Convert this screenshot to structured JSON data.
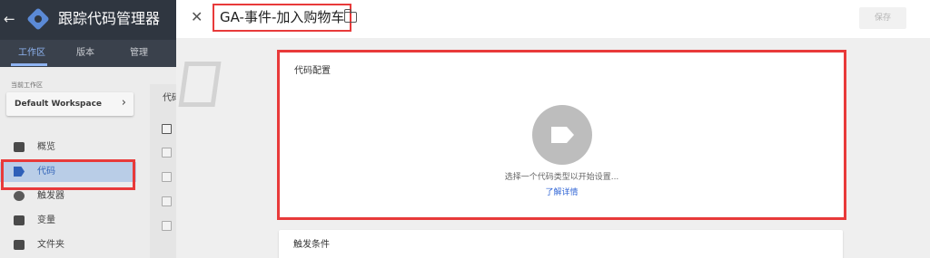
{
  "app": {
    "title": "跟踪代码管理器",
    "tabs": [
      "工作区",
      "版本",
      "管理"
    ],
    "workspace": {
      "label": "当前工作区",
      "name": "Default Workspace"
    },
    "nav": [
      {
        "label": "概览",
        "icon": "overview-icon"
      },
      {
        "label": "代码",
        "icon": "tag-icon"
      },
      {
        "label": "触发器",
        "icon": "trigger-icon"
      },
      {
        "label": "变量",
        "icon": "variable-icon"
      },
      {
        "label": "文件夹",
        "icon": "folder-icon"
      }
    ],
    "content_heading": "代码"
  },
  "editor": {
    "tag_name": "GA-事件-加入购物车",
    "save_label": "保存",
    "config_card": {
      "title": "代码配置",
      "hint": "选择一个代码类型以开始设置...",
      "learn_more": "了解详情"
    },
    "trigger_card": {
      "title": "触发条件"
    }
  },
  "colors": {
    "highlight": "#e83a3a",
    "link": "#3367d6",
    "topbar": "#2f3640"
  }
}
